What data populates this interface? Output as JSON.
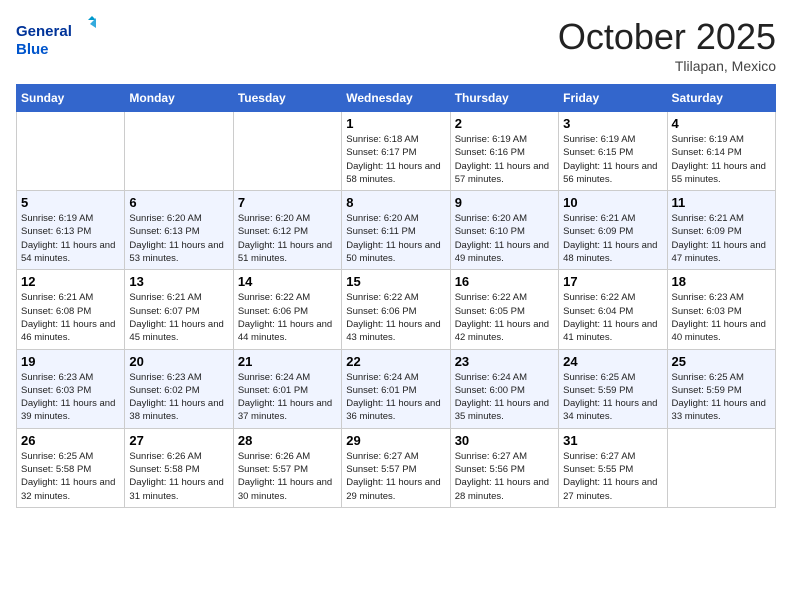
{
  "logo": {
    "line1": "General",
    "line2": "Blue"
  },
  "title": "October 2025",
  "location": "Tlilapan, Mexico",
  "weekdays": [
    "Sunday",
    "Monday",
    "Tuesday",
    "Wednesday",
    "Thursday",
    "Friday",
    "Saturday"
  ],
  "weeks": [
    [
      {
        "day": "",
        "info": ""
      },
      {
        "day": "",
        "info": ""
      },
      {
        "day": "",
        "info": ""
      },
      {
        "day": "1",
        "sunrise": "6:18 AM",
        "sunset": "6:17 PM",
        "daylight": "11 hours and 58 minutes."
      },
      {
        "day": "2",
        "sunrise": "6:19 AM",
        "sunset": "6:16 PM",
        "daylight": "11 hours and 57 minutes."
      },
      {
        "day": "3",
        "sunrise": "6:19 AM",
        "sunset": "6:15 PM",
        "daylight": "11 hours and 56 minutes."
      },
      {
        "day": "4",
        "sunrise": "6:19 AM",
        "sunset": "6:14 PM",
        "daylight": "11 hours and 55 minutes."
      }
    ],
    [
      {
        "day": "5",
        "sunrise": "6:19 AM",
        "sunset": "6:13 PM",
        "daylight": "11 hours and 54 minutes."
      },
      {
        "day": "6",
        "sunrise": "6:20 AM",
        "sunset": "6:13 PM",
        "daylight": "11 hours and 53 minutes."
      },
      {
        "day": "7",
        "sunrise": "6:20 AM",
        "sunset": "6:12 PM",
        "daylight": "11 hours and 51 minutes."
      },
      {
        "day": "8",
        "sunrise": "6:20 AM",
        "sunset": "6:11 PM",
        "daylight": "11 hours and 50 minutes."
      },
      {
        "day": "9",
        "sunrise": "6:20 AM",
        "sunset": "6:10 PM",
        "daylight": "11 hours and 49 minutes."
      },
      {
        "day": "10",
        "sunrise": "6:21 AM",
        "sunset": "6:09 PM",
        "daylight": "11 hours and 48 minutes."
      },
      {
        "day": "11",
        "sunrise": "6:21 AM",
        "sunset": "6:09 PM",
        "daylight": "11 hours and 47 minutes."
      }
    ],
    [
      {
        "day": "12",
        "sunrise": "6:21 AM",
        "sunset": "6:08 PM",
        "daylight": "11 hours and 46 minutes."
      },
      {
        "day": "13",
        "sunrise": "6:21 AM",
        "sunset": "6:07 PM",
        "daylight": "11 hours and 45 minutes."
      },
      {
        "day": "14",
        "sunrise": "6:22 AM",
        "sunset": "6:06 PM",
        "daylight": "11 hours and 44 minutes."
      },
      {
        "day": "15",
        "sunrise": "6:22 AM",
        "sunset": "6:06 PM",
        "daylight": "11 hours and 43 minutes."
      },
      {
        "day": "16",
        "sunrise": "6:22 AM",
        "sunset": "6:05 PM",
        "daylight": "11 hours and 42 minutes."
      },
      {
        "day": "17",
        "sunrise": "6:22 AM",
        "sunset": "6:04 PM",
        "daylight": "11 hours and 41 minutes."
      },
      {
        "day": "18",
        "sunrise": "6:23 AM",
        "sunset": "6:03 PM",
        "daylight": "11 hours and 40 minutes."
      }
    ],
    [
      {
        "day": "19",
        "sunrise": "6:23 AM",
        "sunset": "6:03 PM",
        "daylight": "11 hours and 39 minutes."
      },
      {
        "day": "20",
        "sunrise": "6:23 AM",
        "sunset": "6:02 PM",
        "daylight": "11 hours and 38 minutes."
      },
      {
        "day": "21",
        "sunrise": "6:24 AM",
        "sunset": "6:01 PM",
        "daylight": "11 hours and 37 minutes."
      },
      {
        "day": "22",
        "sunrise": "6:24 AM",
        "sunset": "6:01 PM",
        "daylight": "11 hours and 36 minutes."
      },
      {
        "day": "23",
        "sunrise": "6:24 AM",
        "sunset": "6:00 PM",
        "daylight": "11 hours and 35 minutes."
      },
      {
        "day": "24",
        "sunrise": "6:25 AM",
        "sunset": "5:59 PM",
        "daylight": "11 hours and 34 minutes."
      },
      {
        "day": "25",
        "sunrise": "6:25 AM",
        "sunset": "5:59 PM",
        "daylight": "11 hours and 33 minutes."
      }
    ],
    [
      {
        "day": "26",
        "sunrise": "6:25 AM",
        "sunset": "5:58 PM",
        "daylight": "11 hours and 32 minutes."
      },
      {
        "day": "27",
        "sunrise": "6:26 AM",
        "sunset": "5:58 PM",
        "daylight": "11 hours and 31 minutes."
      },
      {
        "day": "28",
        "sunrise": "6:26 AM",
        "sunset": "5:57 PM",
        "daylight": "11 hours and 30 minutes."
      },
      {
        "day": "29",
        "sunrise": "6:27 AM",
        "sunset": "5:57 PM",
        "daylight": "11 hours and 29 minutes."
      },
      {
        "day": "30",
        "sunrise": "6:27 AM",
        "sunset": "5:56 PM",
        "daylight": "11 hours and 28 minutes."
      },
      {
        "day": "31",
        "sunrise": "6:27 AM",
        "sunset": "5:55 PM",
        "daylight": "11 hours and 27 minutes."
      },
      {
        "day": "",
        "info": ""
      }
    ]
  ]
}
